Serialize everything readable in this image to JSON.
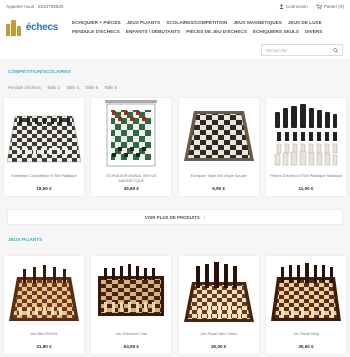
{
  "topbar": {
    "phone": "Appelez-nous : 0233759829",
    "login": "Connexion",
    "cart": "Panier (0)"
  },
  "logo": {
    "text": "échecs"
  },
  "nav": [
    "ÉCHIQUIER + PIÈCES",
    "JEUX PLIANTS",
    "SCOLAIRES/COMPÉTITION",
    "JEUX MAGNÉTIQUES",
    "JEUX DE LUXE",
    "PENDULE D'ÉCHECS",
    "ENFANTS / DÉBUTANTS",
    "PIÈCES DE JEU D'ÉCHECS",
    "ÉCHIQUIERS SEULS",
    "DIVERS"
  ],
  "search": {
    "placeholder": "Rechercher"
  },
  "section1": {
    "title": "COMPÉTITION/SCOLAIRES",
    "tabs": [
      "Pendule d'échecs",
      "Taille 3",
      "Taille 4",
      "Taille 5",
      "Taille 6"
    ],
    "products": [
      {
        "name": "Ensemble Compétition N°5/6 Plastique",
        "price": "16,50 €"
      },
      {
        "name": "ÉCHIQUIER MURAL VINYLE MAGNÉTIQUE",
        "price": "49,80 €"
      },
      {
        "name": "Échiquier Taille 5/6 Vinyle Souple",
        "price": "6,90 €"
      },
      {
        "name": "Pièces D'échecs N°5/6 Plastique Standard",
        "price": "11,00 €"
      }
    ],
    "more": "VOIR PLUS DE PRODUITS"
  },
  "section2": {
    "title": "JEUX PLIANTS",
    "products": [
      {
        "name": "Jeu Mini ROYAL",
        "price": "31,90 €"
      },
      {
        "name": "Jeu D'échecs Club",
        "price": "64,90 €"
      },
      {
        "name": "Jeu Royal Mini Chess",
        "price": "36,00 €"
      },
      {
        "name": "Jeu Small King",
        "price": "35,60 €"
      }
    ]
  }
}
